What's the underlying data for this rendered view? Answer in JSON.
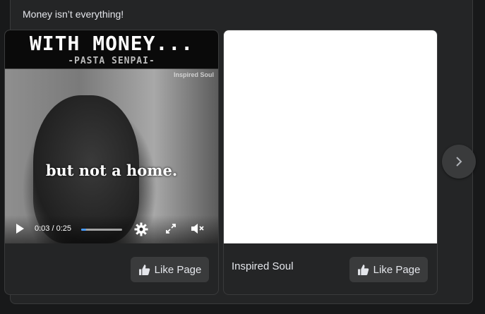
{
  "post": {
    "caption": "Money isn’t everything!"
  },
  "cards": [
    {
      "video": {
        "title_text": "WITH MONEY...",
        "subtitle_text": "-PASTA SENPAI-",
        "watermark": "Inspired Soul",
        "caption_text": "but not a home.",
        "time_display": "0:03 / 0:25",
        "progress_fraction": 0.12
      },
      "like_label": "Like Page"
    },
    {
      "page_name": "Inspired Soul",
      "like_label": "Like Page"
    }
  ],
  "carousel": {
    "next_icon": "chevron-right-icon"
  },
  "colors": {
    "background": "#18191a",
    "surface": "#242526",
    "button": "#3a3b3c",
    "accent": "#4599ff",
    "text": "#e4e6eb"
  }
}
